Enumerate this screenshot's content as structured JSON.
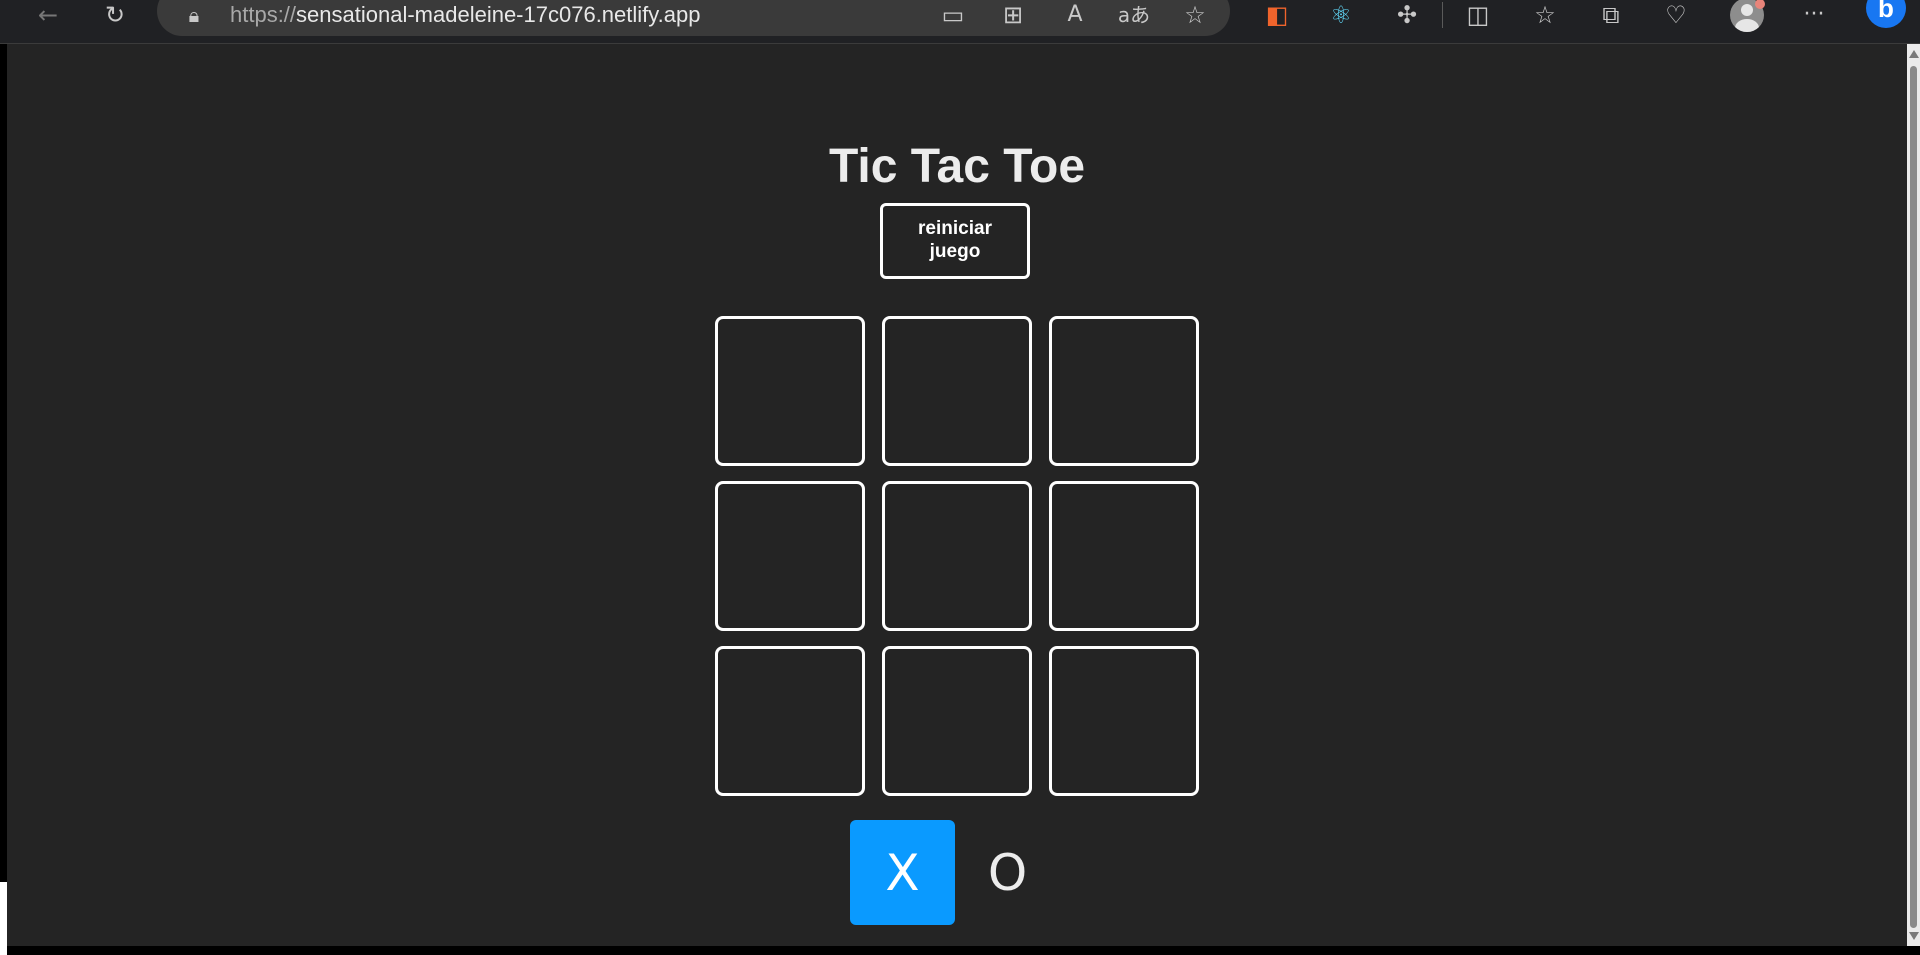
{
  "browser": {
    "url_scheme": "https://",
    "url_host": "sensational-madeleine-17c076.netlify.app",
    "icons": [
      "back-icon",
      "refresh-icon",
      "lock-icon",
      "devices-icon",
      "apps-icon",
      "read-aloud-icon",
      "translate-icon",
      "favorite-star-icon",
      "extension-icon",
      "react-devtools-icon",
      "extensions-puzzle-icon",
      "split-screen-icon",
      "favorites-icon",
      "collections-icon",
      "browser-essentials-icon",
      "profile-icon",
      "more-menu-icon",
      "bing-icon"
    ],
    "glyphs": {
      "back": "←",
      "refresh": "↻",
      "lock": "🔒︎",
      "devices": "▭",
      "apps": "⊞",
      "read_aloud": "A",
      "translate": "aあ",
      "favorite": "☆",
      "extension": "◧",
      "react": "⚛",
      "puzzle": "✣",
      "split": "◫",
      "favorites": "☆",
      "collections": "⧉",
      "health": "♡",
      "more": "···",
      "bing": "b"
    }
  },
  "app": {
    "title": "Tic Tac Toe",
    "reset_label": "reiniciar juego",
    "board": [
      "",
      "",
      "",
      "",
      "",
      "",
      "",
      "",
      ""
    ],
    "turn_x": "X",
    "turn_o": "O",
    "current_turn": "X"
  },
  "colors": {
    "background": "#242424",
    "accent": "#0a9aff",
    "text": "#ececec",
    "border": "#ffffff"
  }
}
